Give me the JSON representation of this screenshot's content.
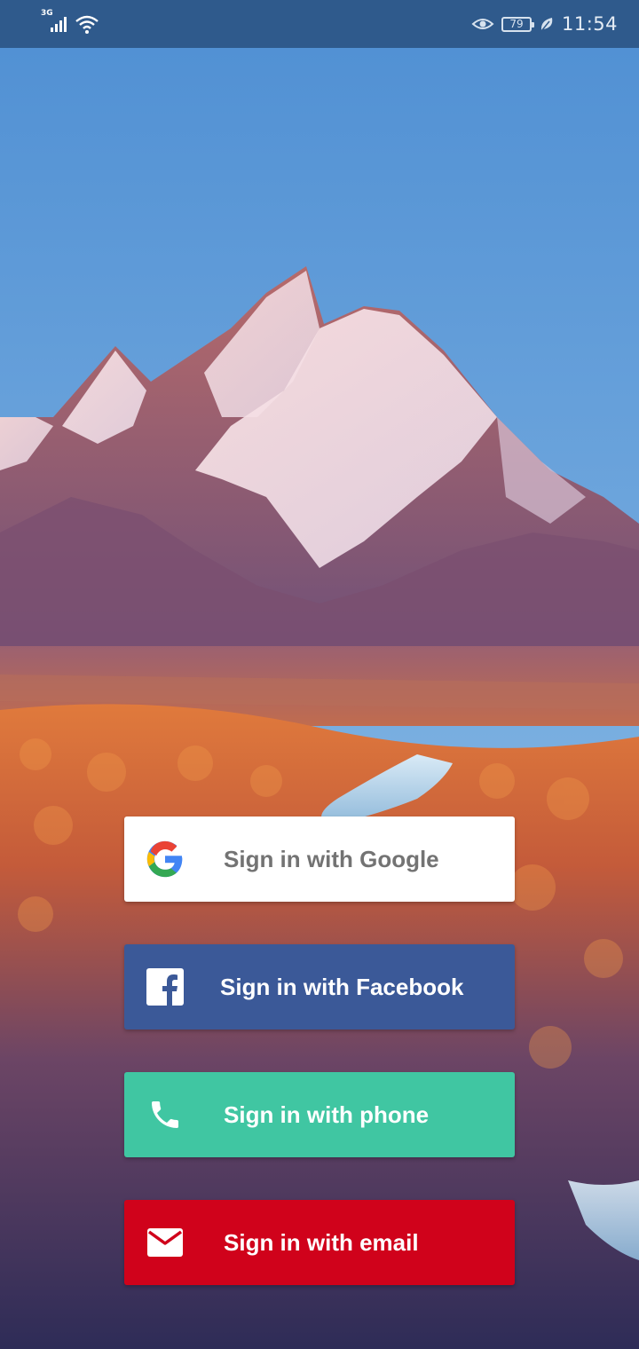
{
  "status_bar": {
    "network_type": "3G",
    "battery_level": "79",
    "time": "11:54",
    "background_color": "#2f5a8c",
    "icons": [
      "signal-icon",
      "wifi-icon",
      "eye-comfort-icon",
      "battery-icon",
      "power-saver-leaf-icon"
    ]
  },
  "background": {
    "description_icon": "mountain-landscape-wallpaper"
  },
  "sign_in": {
    "google": {
      "label": "Sign in with Google",
      "icon": "google-icon",
      "color": "#ffffff",
      "text_color": "#737373"
    },
    "facebook": {
      "label": "Sign in with Facebook",
      "icon": "facebook-icon",
      "color": "#3b5998"
    },
    "phone": {
      "label": "Sign in with phone",
      "icon": "phone-icon",
      "color": "#40c6a2"
    },
    "email": {
      "label": "Sign in with email",
      "icon": "email-icon",
      "color": "#d0021b"
    }
  }
}
